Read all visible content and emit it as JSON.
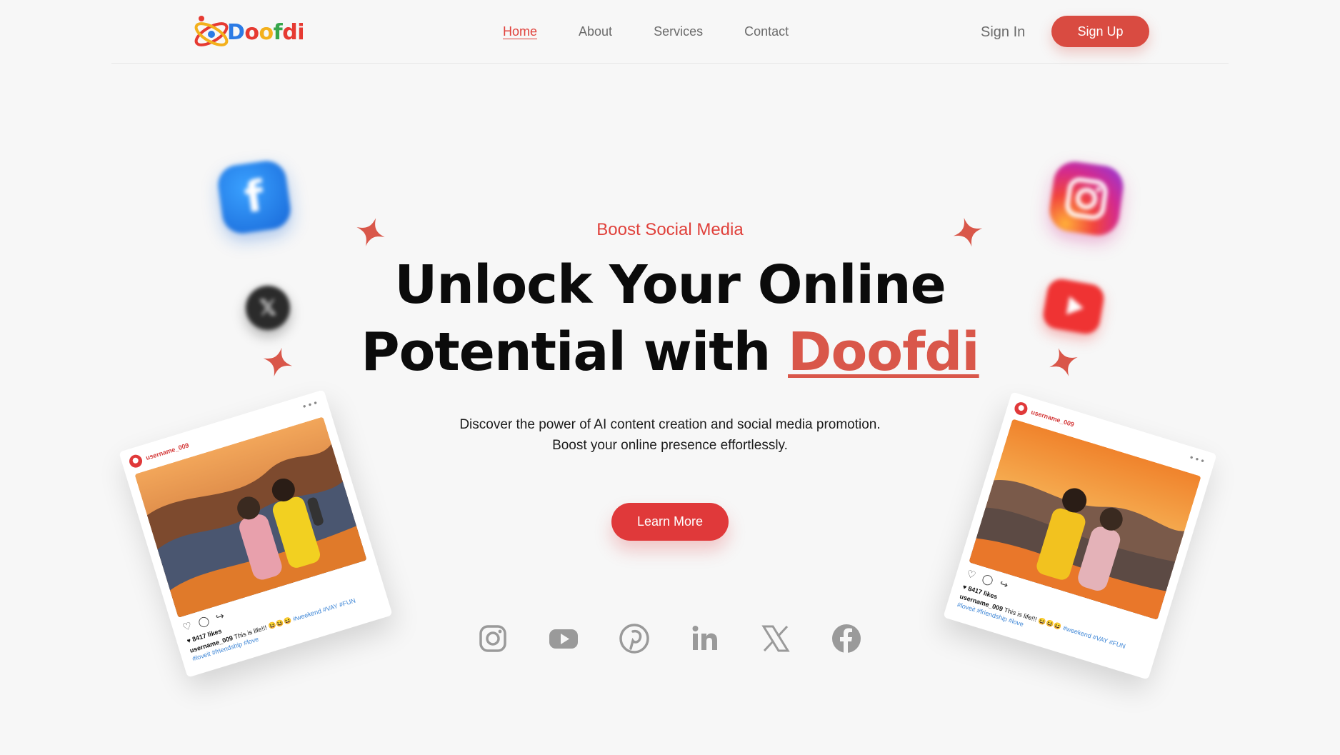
{
  "brand": {
    "logo_text": "Doofdi"
  },
  "nav": {
    "items": [
      {
        "label": "Home"
      },
      {
        "label": "About"
      },
      {
        "label": "Services"
      },
      {
        "label": "Contact"
      }
    ]
  },
  "auth": {
    "signin_label": "Sign In",
    "signup_label": "Sign Up"
  },
  "hero": {
    "kicker": "Boost Social Media",
    "headline_line1": "Unlock Your Online",
    "headline_line2_prefix": "Potential with",
    "headline_brand": "Doofdi",
    "sub_line1": "Discover the power of AI content creation and social media promotion.",
    "sub_line2": "Boost your online presence effortlessly.",
    "cta_label": "Learn More"
  },
  "social_row": {
    "icons": [
      "instagram-icon",
      "youtube-icon",
      "pinterest-icon",
      "linkedin-icon",
      "x-icon",
      "facebook-icon"
    ]
  },
  "posts": [
    {
      "username": "username_009",
      "likes": "8417 likes",
      "caption_user": "username_009",
      "caption_text": "This is life!!! 😆😆😆",
      "tags": "#weekend #VAY #FUN #loveit #friendship #love"
    },
    {
      "username": "username_009",
      "likes": "8417 likes",
      "caption_user": "username_009",
      "caption_text": "This is life!!! 😆😆😆",
      "tags": "#weekend #VAY #FUN #loveit #friendship #love"
    }
  ],
  "colors": {
    "accent": "#e0413b",
    "brand_red": "#d9574a",
    "background": "#f7f7f7"
  }
}
